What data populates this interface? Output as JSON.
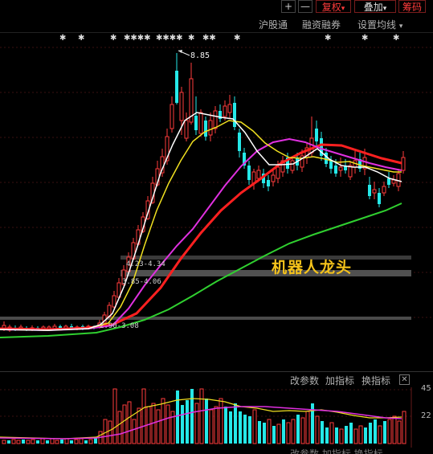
{
  "topbar": {
    "buttons": [
      "+",
      "—"
    ],
    "restore": "复权",
    "overlay": "叠加",
    "chips": "筹码",
    "restore_arrow": "▾",
    "overlay_arrow": "▾"
  },
  "toolbar": {
    "hk_connect": "沪股通",
    "margin": "融资融券",
    "ma_settings": "设置均线",
    "ma_arrow": "▾"
  },
  "chart": {
    "high_label": "8.85",
    "zones": [
      "4.23-4.34",
      "3.85-4.06",
      "2.90-3.08"
    ],
    "banner": "机器人龙头",
    "colors": {
      "up": "#ff3b3b",
      "down": "#25e8e8",
      "ma5": "#ffffff",
      "ma10": "#f0e020",
      "ma20": "#e030e0",
      "ma30": "#ff2020",
      "ma60": "#30d030"
    }
  },
  "indicator": {
    "params": "改参数",
    "add": "加指标",
    "switch": "换指标",
    "close": "✕",
    "ticks": [
      "45",
      "22"
    ]
  },
  "footer": {
    "cut_text": "改参数  加指标  换指标"
  }
}
